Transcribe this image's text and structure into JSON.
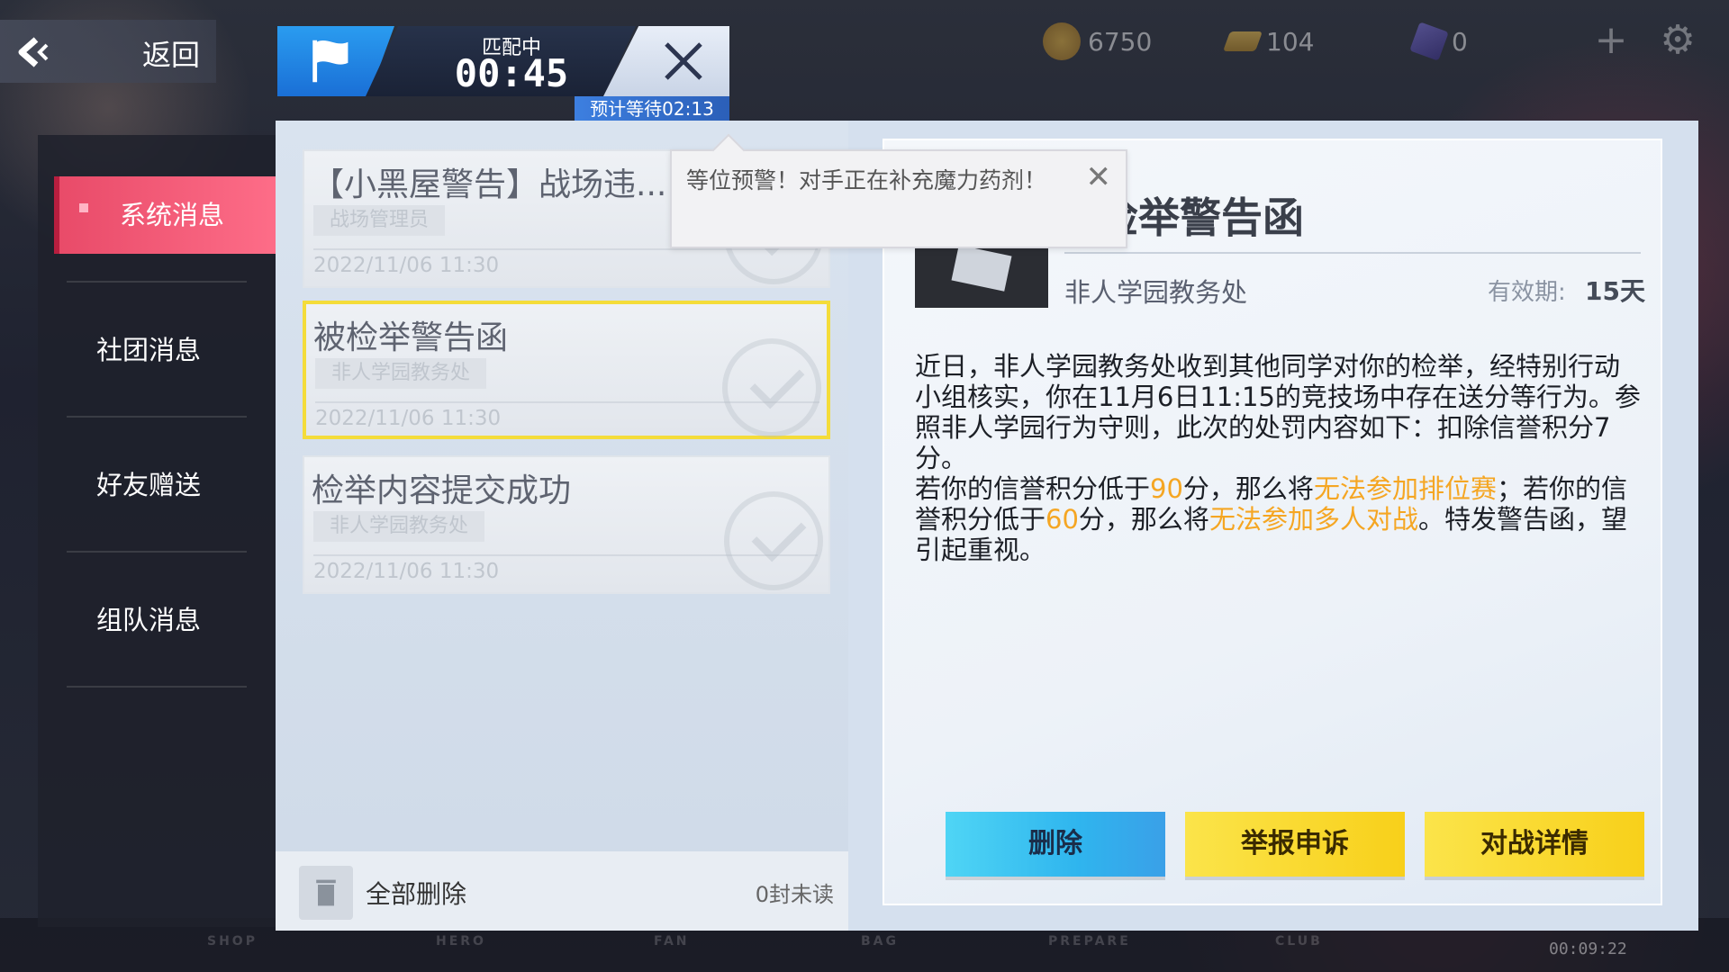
{
  "topbar": {
    "back_label": "返回",
    "currencies": [
      {
        "name": "coin",
        "value": "6750",
        "color": "#d4a017"
      },
      {
        "name": "gold-bar",
        "value": "104",
        "color": "#d9a230"
      },
      {
        "name": "gem",
        "value": "0",
        "color": "#6a5acd"
      }
    ]
  },
  "matchmaking": {
    "status": "匹配中",
    "timer": "00:45",
    "estimated_wait": "预计等待02:13"
  },
  "sidebar": {
    "items": [
      {
        "label": "系统消息",
        "active": true
      },
      {
        "label": "社团消息",
        "active": false
      },
      {
        "label": "好友赠送",
        "active": false
      },
      {
        "label": "组队消息",
        "active": false
      }
    ]
  },
  "messages": [
    {
      "title": "【小黑屋警告】战场违...",
      "sender": "战场管理员",
      "date": "2022/11/06 11:30",
      "selected": false
    },
    {
      "title": "被检举警告函",
      "sender": "非人学园教务处",
      "date": "2022/11/06 11:30",
      "selected": true
    },
    {
      "title": "检举内容提交成功",
      "sender": "非人学园教务处",
      "date": "2022/11/06 11:30",
      "selected": false
    }
  ],
  "list_footer": {
    "delete_all": "全部删除",
    "unread": "0封未读"
  },
  "toast": {
    "text": "等位预警！对手正在补充魔力药剂！"
  },
  "detail": {
    "title": "检举警告函",
    "sender": "非人学园教务处",
    "validity_label": "有效期:",
    "validity_value": "15天",
    "body_p1": "近日，非人学园教务处收到其他同学对你的检举，经特别行动小组核实，你在11月6日11:15的竞技场中存在送分等行为。参照非人学园行为守则，此次的处罚内容如下：扣除信誉积分7分。",
    "body_p2_a": "若你的信誉积分低于",
    "body_p2_num1": "90",
    "body_p2_b": "分，那么将",
    "body_p2_hl1": "无法参加排位赛",
    "body_p2_c": "；若你的信誉积分低于",
    "body_p2_num2": "60",
    "body_p2_d": "分，那么将",
    "body_p2_hl2": "无法参加多人对战",
    "body_p2_e": "。特发警告函，望引起重视。",
    "buttons": {
      "delete": "删除",
      "appeal": "举报申诉",
      "battle_details": "对战详情"
    }
  },
  "bottom_nav": [
    "SHOP",
    "HERO",
    "FAN",
    "BAG",
    "PREPARE",
    "CLUB"
  ],
  "clock": "00:09:22"
}
